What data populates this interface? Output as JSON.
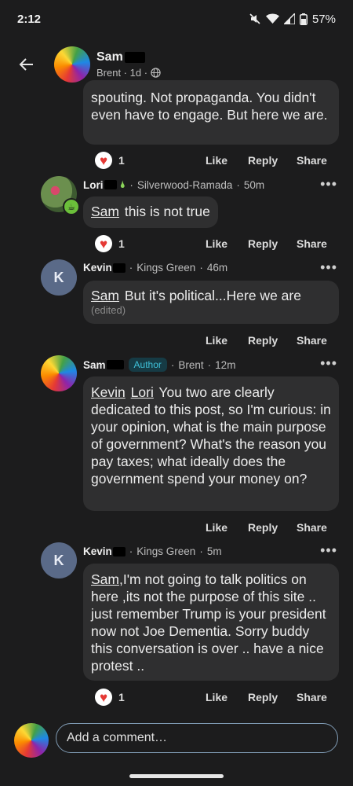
{
  "status": {
    "time": "2:12",
    "battery": "57%"
  },
  "header": {
    "name": "Sam",
    "sub": "Brent · 1d ·"
  },
  "c0": {
    "text": "spouting. Not propaganda. You didn't even have to engage. But here we are.",
    "reactions": "1",
    "like": "Like",
    "reply": "Reply",
    "share": "Share"
  },
  "c1": {
    "name": "Lori",
    "place": "Silverwood-Ramada",
    "time": "50m",
    "mention": "Sam",
    "text": "this is not true",
    "reactions": "1",
    "like": "Like",
    "reply": "Reply",
    "share": "Share"
  },
  "c2": {
    "name": "Kevin",
    "initial": "K",
    "place": "Kings Green",
    "time": "46m",
    "mention": "Sam",
    "text": "But it's political...Here we are",
    "edited": "(edited)",
    "like": "Like",
    "reply": "Reply",
    "share": "Share"
  },
  "c3": {
    "name": "Sam",
    "badge": "Author",
    "place": "Brent",
    "time": "12m",
    "mention1": "Kevin",
    "mention2": "Lori",
    "text": "You two are clearly dedicated to this post, so I'm curious: in your opinion, what is the main purpose of government? What's the reason you pay taxes; what ideally does the government spend your money on?",
    "like": "Like",
    "reply": "Reply",
    "share": "Share"
  },
  "c4": {
    "name": "Kevin",
    "initial": "K",
    "place": "Kings Green",
    "time": "5m",
    "mention": "Sam",
    "text": ",I'm not going to talk politics on here ,its not the purpose of this site .. just remember Trump is your president now not Joe Dementia. Sorry buddy this conversation is over .. have a nice protest ..",
    "reactions": "1",
    "like": "Like",
    "reply": "Reply",
    "share": "Share"
  },
  "composer": {
    "placeholder": "Add a comment…"
  },
  "colors": {
    "background": "#1c1c1d",
    "bubble": "#2f2f30",
    "author_badge": "#3fc0d8",
    "heart": "#e53935"
  }
}
